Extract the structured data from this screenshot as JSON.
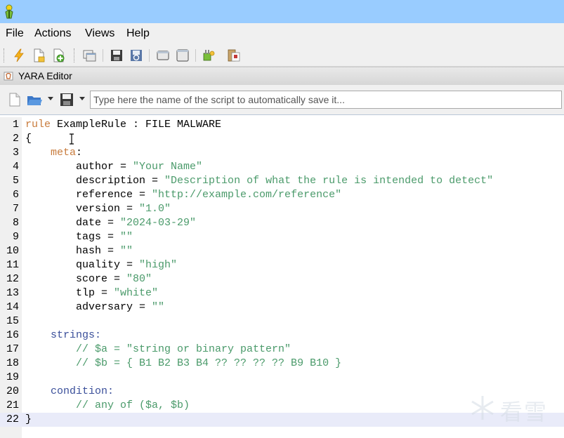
{
  "menu": {
    "file": "File",
    "actions": "Actions",
    "views": "Views",
    "help": "Help"
  },
  "toolbar": {
    "icons": [
      "lightning-icon",
      "new-document-icon",
      "add-document-icon",
      "windows-icon",
      "save-icon",
      "refresh-icon",
      "restore-window-icon",
      "maximize-window-icon",
      "plugin-icon",
      "script-icon"
    ]
  },
  "panel": {
    "title": "YARA Editor"
  },
  "editor_toolbar": {
    "script_name_value": "",
    "script_name_placeholder": "Type here the name of the script to automatically save it..."
  },
  "colors": {
    "titlebar": "#99ccff",
    "keyword": "#c87b3c",
    "section": "#3a4f9a",
    "string": "#4a9a6a",
    "current_line": "#e9ebf9"
  },
  "code": {
    "lines": [
      {
        "n": "1",
        "tokens": [
          {
            "t": "rule",
            "c": "kw"
          },
          {
            "t": " ExampleRule : FILE MALWARE",
            "c": "plain"
          }
        ]
      },
      {
        "n": "2",
        "tokens": [
          {
            "t": "{",
            "c": "plain"
          }
        ]
      },
      {
        "n": "3",
        "tokens": [
          {
            "t": "    ",
            "c": "plain"
          },
          {
            "t": "meta",
            "c": "kw"
          },
          {
            "t": ":",
            "c": "plain"
          }
        ]
      },
      {
        "n": "4",
        "tokens": [
          {
            "t": "        author = ",
            "c": "plain"
          },
          {
            "t": "\"Your Name\"",
            "c": "str"
          }
        ]
      },
      {
        "n": "5",
        "tokens": [
          {
            "t": "        description = ",
            "c": "plain"
          },
          {
            "t": "\"Description of what the rule is intended to detect\"",
            "c": "str"
          }
        ]
      },
      {
        "n": "6",
        "tokens": [
          {
            "t": "        reference = ",
            "c": "plain"
          },
          {
            "t": "\"http://example.com/reference\"",
            "c": "str"
          }
        ]
      },
      {
        "n": "7",
        "tokens": [
          {
            "t": "        version = ",
            "c": "plain"
          },
          {
            "t": "\"1.0\"",
            "c": "str"
          }
        ]
      },
      {
        "n": "8",
        "tokens": [
          {
            "t": "        date = ",
            "c": "plain"
          },
          {
            "t": "\"2024-03-29\"",
            "c": "str"
          }
        ]
      },
      {
        "n": "9",
        "tokens": [
          {
            "t": "        tags = ",
            "c": "plain"
          },
          {
            "t": "\"\"",
            "c": "str"
          }
        ]
      },
      {
        "n": "10",
        "tokens": [
          {
            "t": "        hash = ",
            "c": "plain"
          },
          {
            "t": "\"\"",
            "c": "str"
          }
        ]
      },
      {
        "n": "11",
        "tokens": [
          {
            "t": "        quality = ",
            "c": "plain"
          },
          {
            "t": "\"high\"",
            "c": "str"
          }
        ]
      },
      {
        "n": "12",
        "tokens": [
          {
            "t": "        score = ",
            "c": "plain"
          },
          {
            "t": "\"80\"",
            "c": "str"
          }
        ]
      },
      {
        "n": "13",
        "tokens": [
          {
            "t": "        tlp = ",
            "c": "plain"
          },
          {
            "t": "\"white\"",
            "c": "str"
          }
        ]
      },
      {
        "n": "14",
        "tokens": [
          {
            "t": "        adversary = ",
            "c": "plain"
          },
          {
            "t": "\"\"",
            "c": "str"
          }
        ]
      },
      {
        "n": "15",
        "tokens": []
      },
      {
        "n": "16",
        "tokens": [
          {
            "t": "    ",
            "c": "plain"
          },
          {
            "t": "strings:",
            "c": "sec"
          }
        ]
      },
      {
        "n": "17",
        "tokens": [
          {
            "t": "        // $a = \"string or binary pattern\"",
            "c": "cmt"
          }
        ]
      },
      {
        "n": "18",
        "tokens": [
          {
            "t": "        // $b = { B1 B2 B3 B4 ?? ?? ?? ?? B9 B10 }",
            "c": "cmt"
          }
        ]
      },
      {
        "n": "19",
        "tokens": []
      },
      {
        "n": "20",
        "tokens": [
          {
            "t": "    ",
            "c": "plain"
          },
          {
            "t": "condition:",
            "c": "sec"
          }
        ]
      },
      {
        "n": "21",
        "tokens": [
          {
            "t": "        // any of ($a, $b)",
            "c": "cmt"
          }
        ]
      },
      {
        "n": "22",
        "tokens": [
          {
            "t": "}",
            "c": "plain"
          }
        ],
        "current": true
      }
    ]
  },
  "watermark": {
    "text": "看雪"
  }
}
